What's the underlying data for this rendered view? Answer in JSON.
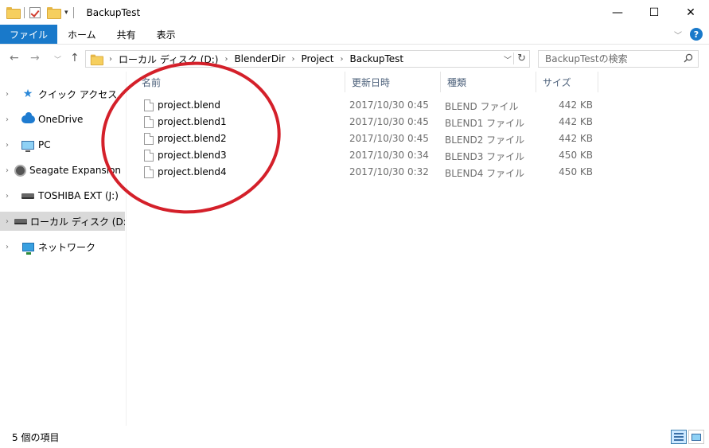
{
  "window": {
    "title": "BackupTest",
    "minimize": "—",
    "maximize": "☐",
    "close": "✕"
  },
  "ribbon": {
    "tabs": [
      {
        "label": "ファイル"
      },
      {
        "label": "ホーム"
      },
      {
        "label": "共有"
      },
      {
        "label": "表示"
      }
    ],
    "collapse_icon": "chevron-down-icon",
    "help_icon": "help-icon"
  },
  "address": {
    "crumbs": [
      "ローカル ディスク (D:)",
      "BlenderDir",
      "Project",
      "BackupTest"
    ],
    "dropdown": "﹀",
    "refresh": "↻"
  },
  "search": {
    "placeholder": "BackupTestの検索"
  },
  "sidebar": {
    "items": [
      {
        "label": "クイック アクセス",
        "icon": "star-icon"
      },
      {
        "label": "OneDrive",
        "icon": "cloud-icon"
      },
      {
        "label": "PC",
        "icon": "computer-icon"
      },
      {
        "label": "Seagate Expansion Dr",
        "icon": "disk-icon"
      },
      {
        "label": "TOSHIBA EXT (J:)",
        "icon": "drive-icon"
      },
      {
        "label": "ローカル ディスク (D:)",
        "icon": "drive-icon",
        "selected": true
      },
      {
        "label": "ネットワーク",
        "icon": "network-icon"
      }
    ]
  },
  "columns": {
    "name": "名前",
    "date": "更新日時",
    "type": "種類",
    "size": "サイズ"
  },
  "files": [
    {
      "name": "project.blend",
      "date": "2017/10/30 0:45",
      "type": "BLEND ファイル",
      "size": "442 KB"
    },
    {
      "name": "project.blend1",
      "date": "2017/10/30 0:45",
      "type": "BLEND1 ファイル",
      "size": "442 KB"
    },
    {
      "name": "project.blend2",
      "date": "2017/10/30 0:45",
      "type": "BLEND2 ファイル",
      "size": "442 KB"
    },
    {
      "name": "project.blend3",
      "date": "2017/10/30 0:34",
      "type": "BLEND3 ファイル",
      "size": "450 KB"
    },
    {
      "name": "project.blend4",
      "date": "2017/10/30 0:32",
      "type": "BLEND4 ファイル",
      "size": "450 KB"
    }
  ],
  "status": {
    "count": "5 個の項目"
  },
  "colors": {
    "accent": "#1979ca",
    "annotation": "#d4202a",
    "selected_bg": "#d9d9d9"
  }
}
